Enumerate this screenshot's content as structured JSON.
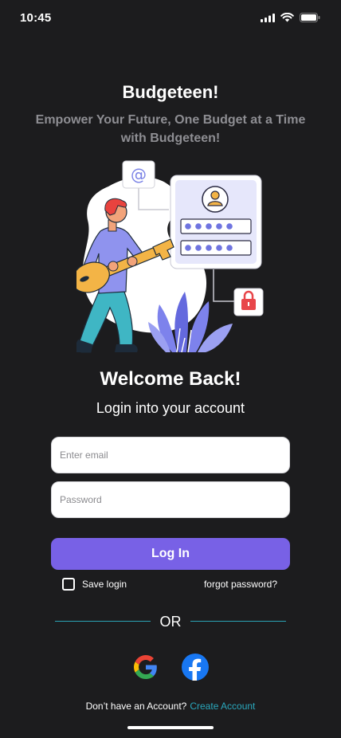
{
  "status": {
    "time": "10:45"
  },
  "app": {
    "title": "Budgeteen!",
    "tagline": "Empower Your Future, One Budget at a Time with Budgeteen!"
  },
  "login": {
    "welcome": "Welcome Back!",
    "subtitle": "Login into your account",
    "email_placeholder": "Enter email",
    "password_placeholder": "Password",
    "button_label": "Log In",
    "save_login_label": "Save login",
    "forgot_label": "forgot password?",
    "or_label": "OR"
  },
  "social": {
    "google_icon": "google-icon",
    "facebook_icon": "facebook-icon"
  },
  "signup": {
    "prompt": "Don’t have an Account?",
    "link": "Create Account"
  },
  "colors": {
    "background": "#1c1c1e",
    "accent": "#7861e6",
    "link": "#2aa8bd",
    "divider": "#2aa3b4"
  }
}
